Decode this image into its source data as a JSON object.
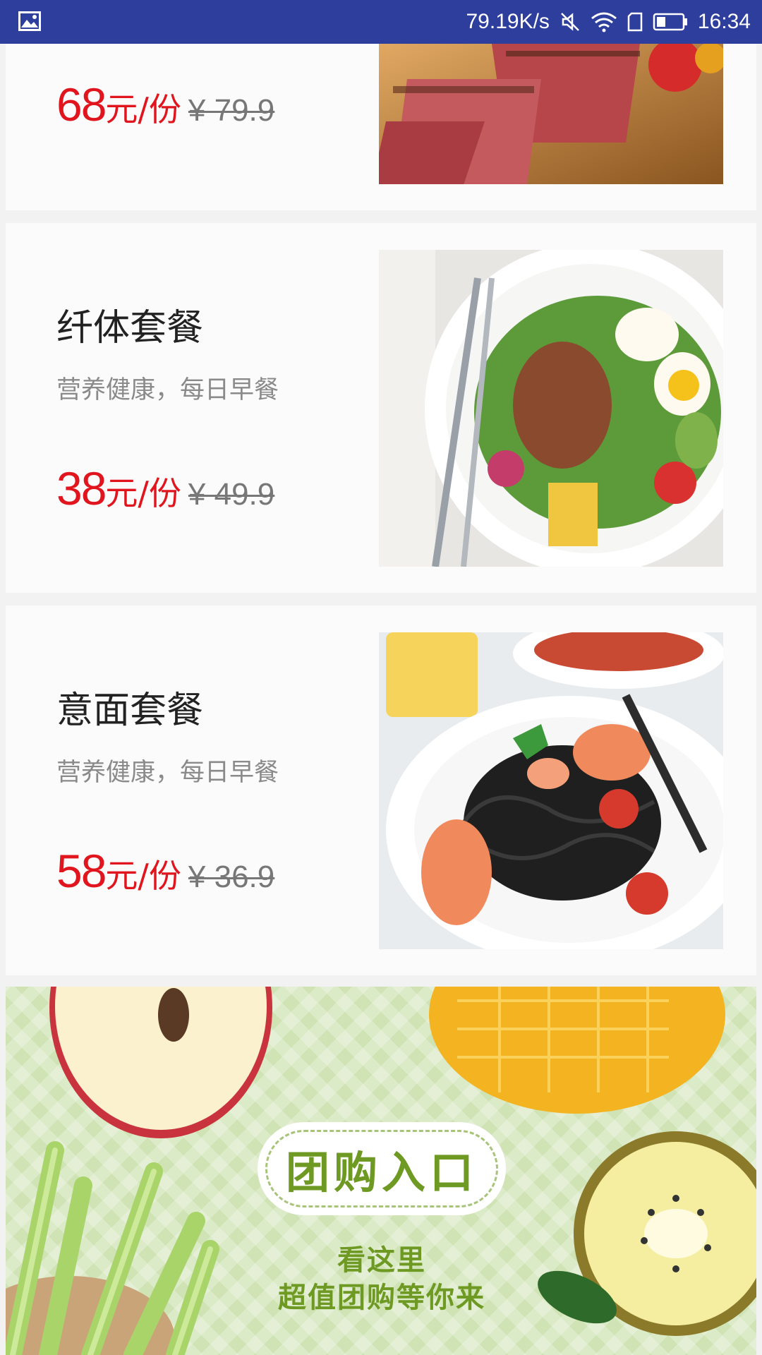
{
  "status_bar": {
    "network_speed": "79.19K/s",
    "time": "16:34",
    "icons": [
      "image-icon",
      "mute-icon",
      "wifi-icon",
      "sim-icon",
      "battery-icon"
    ]
  },
  "products": [
    {
      "price": "68",
      "unit": "元/份",
      "original_price": "¥ 79.9",
      "image": "steak-photo"
    },
    {
      "name": "纤体套餐",
      "description": "营养健康，每日早餐",
      "price": "38",
      "unit": "元/份",
      "original_price": "¥ 49.9",
      "image": "salad-photo"
    },
    {
      "name": "意面套餐",
      "description": "营养健康，每日早餐",
      "price": "58",
      "unit": "元/份",
      "original_price": "¥ 36.9",
      "image": "squid-ink-pasta-photo"
    }
  ],
  "banner": {
    "title": "团购入口",
    "line1": "看这里",
    "line2": "超值团购等你来"
  },
  "colors": {
    "status_bar": "#2d3e9c",
    "price": "#e0151e",
    "banner_text": "#6e9a23"
  }
}
